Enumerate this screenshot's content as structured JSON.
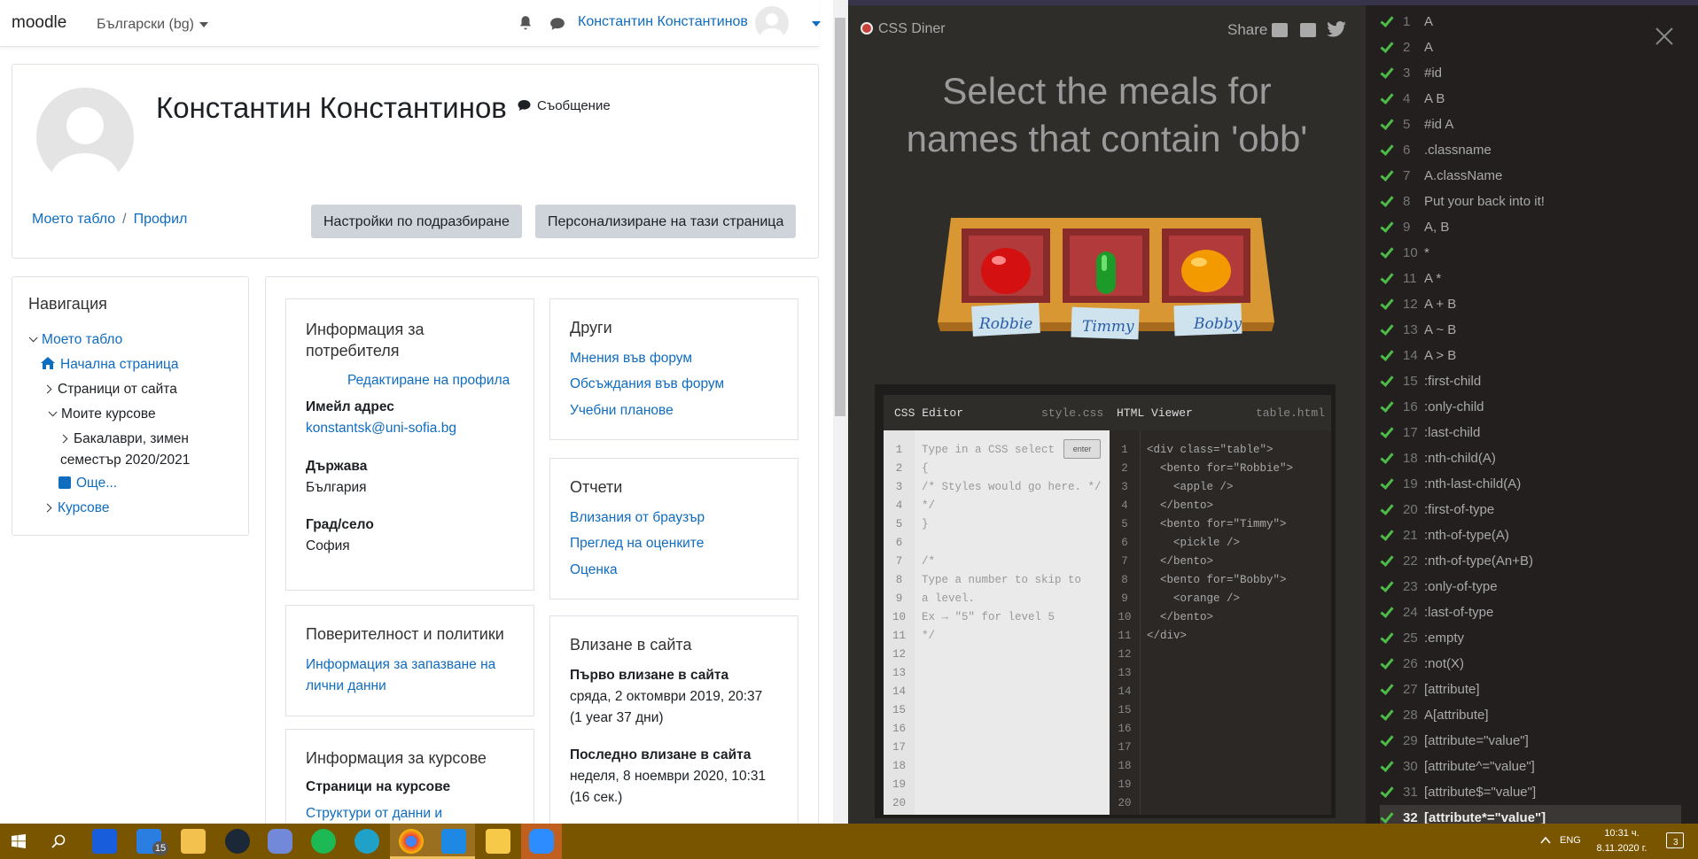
{
  "moodle": {
    "brand": "moodle",
    "language": "Български (bg)",
    "user_name": "Константин Константинов",
    "profile_name": "Константин Константинов",
    "message_label": "Съобщение",
    "breadcrumb": [
      "Моето табло",
      "Профил"
    ],
    "btn_default": "Настройки по подразбиране",
    "btn_customize": "Персонализиране на тази страница",
    "navigation": {
      "title": "Навигация",
      "items": [
        "Моето табло",
        "Начална страница",
        "Страници от сайта",
        "Моите курсове",
        "Бакалаври, зимен",
        "семестър 2020/2021",
        "Още...",
        "Курсове"
      ]
    },
    "user_info": {
      "title": "Информация за потребителя",
      "title_l1": "Информация за",
      "title_l2": "потребителя",
      "edit_link": "Редактиране на профила",
      "email_label": "Имейл адрес",
      "email": "konstantsk@uni-sofia.bg",
      "country_label": "Държава",
      "country": "България",
      "city_label": "Град/село",
      "city": "София"
    },
    "other": {
      "title": "Други",
      "links": [
        "Мнения във форум",
        "Обсъждания във форум",
        "Учебни планове"
      ]
    },
    "reports": {
      "title": "Отчети",
      "links": [
        "Влизания от браузър",
        "Преглед на оценките",
        "Оценка"
      ]
    },
    "privacy": {
      "title": "Поверителност и политики",
      "link_l1": "Информация за запазване на",
      "link_l2": "лични данни"
    },
    "login": {
      "title": "Влизане в сайта",
      "first_label": "Първо влизане в сайта",
      "first_date": "сряда, 2 октомври 2019, 20:37",
      "first_ago": "(1 year 37 дни)",
      "last_label": "Последно влизане в сайта",
      "last_date": "неделя, 8 ноември 2020, 10:31",
      "last_ago": "(16 сек.)"
    },
    "courses": {
      "title": "Информация за курсове",
      "pages_label": "Страници на курсове",
      "link": "Структури от данни и"
    }
  },
  "diner": {
    "logo": "CSS Diner",
    "share": "Share",
    "title_l1": "Select the meals for",
    "title_l2": "names that contain 'obb'",
    "plates": [
      "Robbie",
      "Timmy",
      "Bobby"
    ],
    "css_editor_label": "CSS Editor",
    "css_file": "style.css",
    "html_viewer_label": "HTML Viewer",
    "html_file": "table.html",
    "enter_label": "enter",
    "css_lines": [
      "Type in a CSS select",
      "{",
      "/* Styles would go here. */",
      "*/",
      "}",
      "",
      "/*",
      "Type a number to skip to",
      "a level.",
      "Ex → \"5\" for level 5",
      "*/"
    ],
    "html_lines": [
      "<div class=\"table\">",
      "  <bento for=\"Robbie\">",
      "    <apple />",
      "  </bento>",
      "  <bento for=\"Timmy\">",
      "    <pickle />",
      "  </bento>",
      "  <bento for=\"Bobby\">",
      "    <orange />",
      "  </bento>",
      "</div>"
    ],
    "levels": [
      {
        "n": "1",
        "t": "A"
      },
      {
        "n": "2",
        "t": "A"
      },
      {
        "n": "3",
        "t": "#id"
      },
      {
        "n": "4",
        "t": "A B"
      },
      {
        "n": "5",
        "t": "#id A"
      },
      {
        "n": "6",
        "t": ".classname"
      },
      {
        "n": "7",
        "t": "A.className"
      },
      {
        "n": "8",
        "t": "Put your back into it!"
      },
      {
        "n": "9",
        "t": "A, B"
      },
      {
        "n": "10",
        "t": "*"
      },
      {
        "n": "11",
        "t": "A *"
      },
      {
        "n": "12",
        "t": "A + B"
      },
      {
        "n": "13",
        "t": "A ~ B"
      },
      {
        "n": "14",
        "t": "A > B"
      },
      {
        "n": "15",
        "t": ":first-child"
      },
      {
        "n": "16",
        "t": ":only-child"
      },
      {
        "n": "17",
        "t": ":last-child"
      },
      {
        "n": "18",
        "t": ":nth-child(A)"
      },
      {
        "n": "19",
        "t": ":nth-last-child(A)"
      },
      {
        "n": "20",
        "t": ":first-of-type"
      },
      {
        "n": "21",
        "t": ":nth-of-type(A)"
      },
      {
        "n": "22",
        "t": ":nth-of-type(An+B)"
      },
      {
        "n": "23",
        "t": ":only-of-type"
      },
      {
        "n": "24",
        "t": ":last-of-type"
      },
      {
        "n": "25",
        "t": ":empty"
      },
      {
        "n": "26",
        "t": ":not(X)"
      },
      {
        "n": "27",
        "t": "[attribute]"
      },
      {
        "n": "28",
        "t": "A[attribute]"
      },
      {
        "n": "29",
        "t": "[attribute=\"value\"]"
      },
      {
        "n": "30",
        "t": "[attribute^=\"value\"]"
      },
      {
        "n": "31",
        "t": "[attribute$=\"value\"]"
      },
      {
        "n": "32",
        "t": "[attribute*=\"value\"]"
      }
    ]
  },
  "taskbar": {
    "mail_badge": "15",
    "lang": "ENG",
    "time": "10:31 ч.",
    "date": "8.11.2020 г.",
    "notif_count": "3"
  }
}
